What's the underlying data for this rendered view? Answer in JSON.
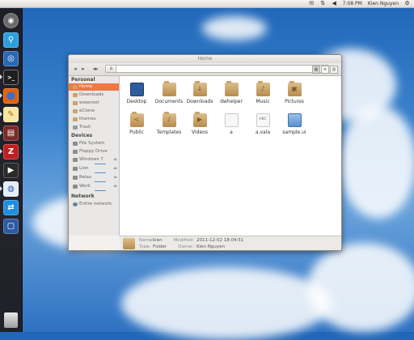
{
  "top_panel": {
    "time": "7:08 PM",
    "user": "Kien Nguyen",
    "icons": [
      "mail-icon",
      "network-icon",
      "volume-icon",
      "clock",
      "user",
      "gear-icon"
    ]
  },
  "launcher": {
    "items": [
      {
        "name": "dash-button",
        "color": "#5f5f5f"
      },
      {
        "name": "app-1",
        "color": "#2d9ee0"
      },
      {
        "name": "app-2",
        "color": "#2c68b4"
      },
      {
        "name": "terminal",
        "color": "#222222"
      },
      {
        "name": "firefox",
        "color": "#e66000"
      },
      {
        "name": "text-editor",
        "color": "#f2b23a"
      },
      {
        "name": "app-7",
        "color": "#8a2a2a"
      },
      {
        "name": "filezilla",
        "color": "#bf1f1f"
      },
      {
        "name": "media-player",
        "color": "#333333"
      },
      {
        "name": "app-10",
        "color": "#3f7ad0"
      },
      {
        "name": "app-11",
        "color": "#1f8de0"
      },
      {
        "name": "app-12",
        "color": "#2d5aa0"
      }
    ]
  },
  "window": {
    "title": "Home",
    "sidebar": {
      "headers": {
        "personal": "Personal",
        "devices": "Devices",
        "network": "Network"
      },
      "personal_items": [
        "Home",
        "Downloads",
        "wwwroot",
        "eClone",
        "themes",
        "Trash"
      ],
      "device_items": [
        "File System",
        "Floppy Drive",
        "Windows 7",
        "Lion",
        "Relax",
        "Work"
      ],
      "network_items": [
        "Entire network"
      ]
    },
    "files": [
      {
        "name": "Desktop",
        "type": "desktop"
      },
      {
        "name": "Documents",
        "type": "folder",
        "glyph": ""
      },
      {
        "name": "Downloads",
        "type": "folder",
        "glyph": "↓"
      },
      {
        "name": "dwhelper",
        "type": "folder",
        "glyph": ""
      },
      {
        "name": "Music",
        "type": "folder",
        "glyph": "♪"
      },
      {
        "name": "Pictures",
        "type": "folder",
        "glyph": "▣"
      },
      {
        "name": "Public",
        "type": "folder",
        "glyph": "<"
      },
      {
        "name": "Templates",
        "type": "folder",
        "glyph": "/"
      },
      {
        "name": "Videos",
        "type": "folder",
        "glyph": "▶"
      },
      {
        "name": "a",
        "type": "doc",
        "glyph": ""
      },
      {
        "name": "a.vala",
        "type": "doc",
        "glyph": "ABC"
      },
      {
        "name": "sample.ui",
        "type": "ui"
      }
    ],
    "status": {
      "name_label": "Name:",
      "name_value": "kien",
      "modified_label": "Modified:",
      "modified_value": "2011-12-02 18:04:51",
      "type_label": "Type:",
      "type_value": "Folder",
      "owner_label": "Owner:",
      "owner_value": "Kien Nguyen"
    }
  }
}
